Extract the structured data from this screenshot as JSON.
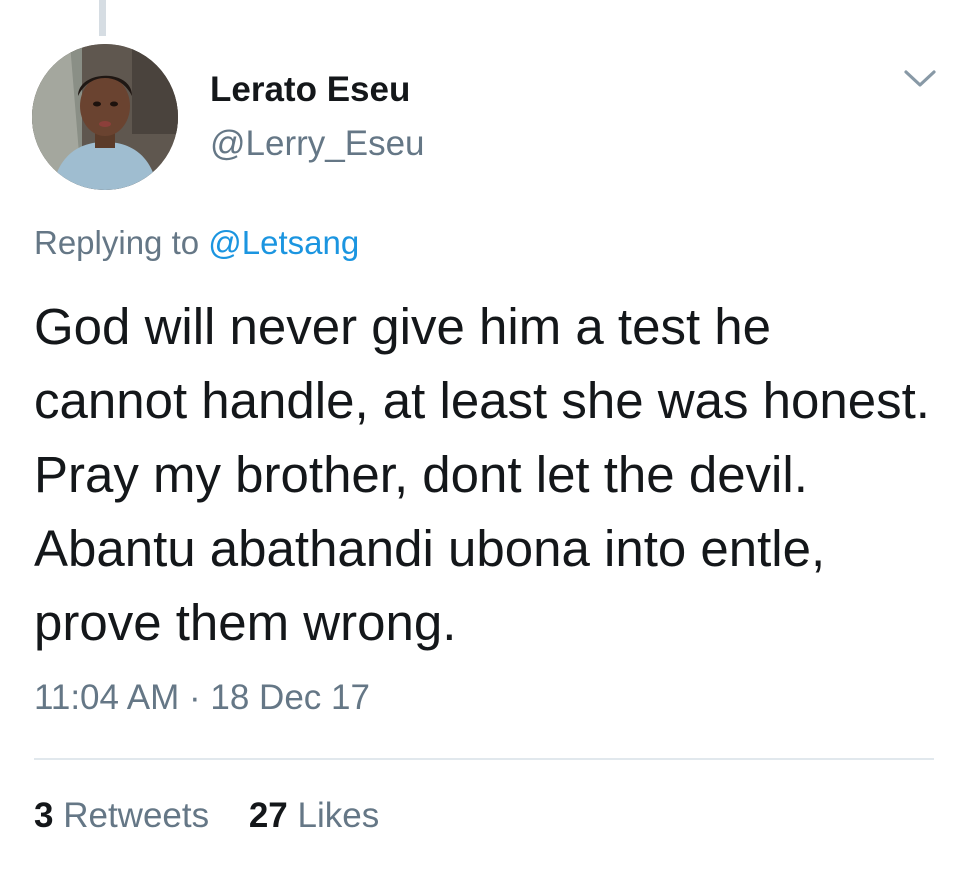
{
  "tweet": {
    "author": {
      "display_name": "Lerato Eseu",
      "handle": "@Lerry_Eseu"
    },
    "reply": {
      "prefix": "Replying to",
      "mention": "@Letsang"
    },
    "text": "God will never give him a test he cannot handle, at least she was honest. Pray my brother, dont let the devil. Abantu abathandi ubona into entle, prove them wrong.",
    "time": "11:04 AM",
    "separator": "·",
    "date": "18 Dec 17",
    "stats": {
      "retweets_count": "3",
      "retweets_label": "Retweets",
      "likes_count": "27",
      "likes_label": "Likes"
    },
    "icons": {
      "menu": "chevron-down-icon"
    },
    "colors": {
      "text": "#14171a",
      "secondary": "#657786",
      "link": "#1b95e0",
      "divider": "#e1e8ed",
      "thread_line": "#d6dde3"
    }
  }
}
